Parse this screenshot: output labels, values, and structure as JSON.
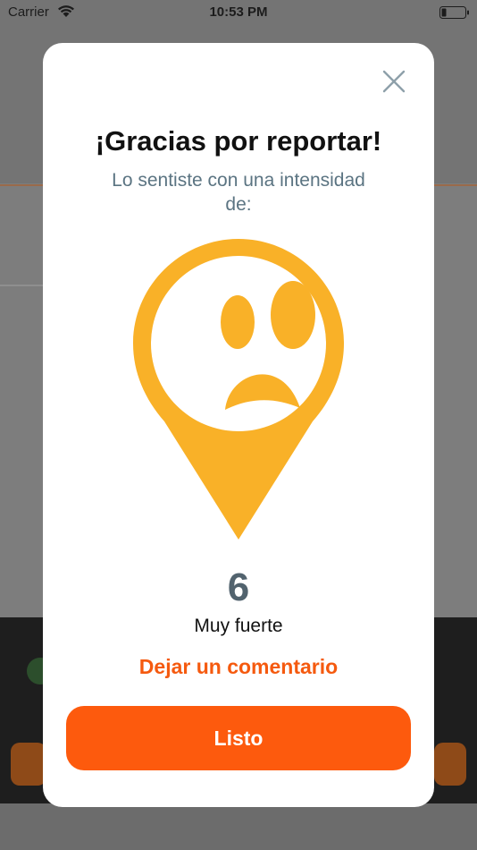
{
  "status_bar": {
    "carrier": "Carrier",
    "time": "10:53 PM"
  },
  "modal": {
    "title": "¡Gracias por reportar!",
    "subtitle": "Lo sentiste con una intensidad de:",
    "intensity_value": "6",
    "intensity_label": "Muy fuerte",
    "comment_link": "Dejar un comentario",
    "done_button": "Listo"
  },
  "colors": {
    "accent": "#fd5a0d",
    "pin": "#f9b128",
    "subtitle": "#5b7482",
    "value": "#52636e"
  },
  "icons": {
    "close": "close-icon",
    "pin": "sad-face-pin-icon",
    "wifi": "wifi-icon",
    "battery": "battery-icon"
  }
}
